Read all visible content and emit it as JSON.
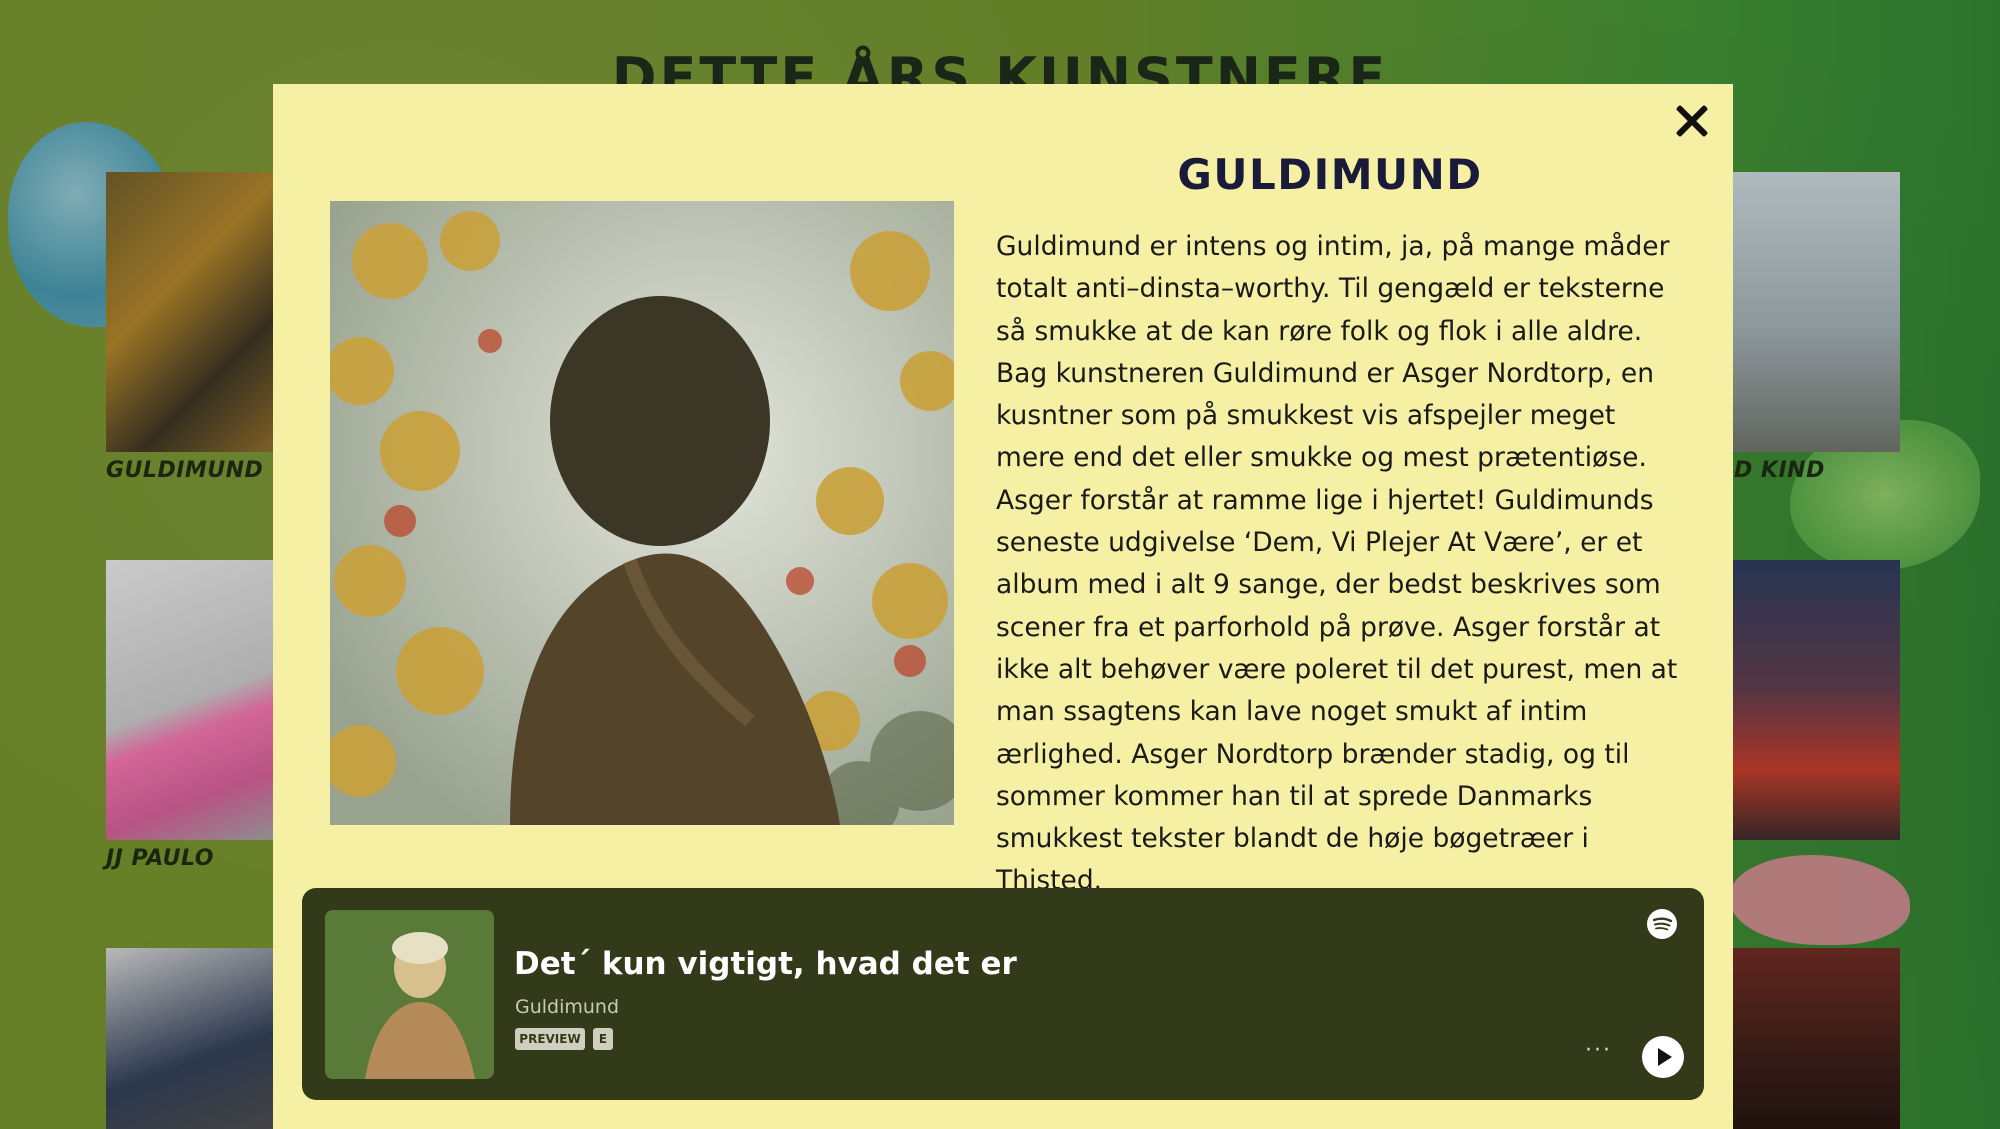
{
  "page": {
    "title": "DETTE ÅRS KUNSTNERE"
  },
  "artists_grid": {
    "left": [
      {
        "label": "GULDIMUND"
      },
      {
        "label": "JJ PAULO"
      },
      {
        "label": ""
      }
    ],
    "right": [
      {
        "label": "D KIND"
      },
      {
        "label": ""
      },
      {
        "label": ""
      }
    ]
  },
  "modal": {
    "close_label": "✕",
    "artist_name": "GULDIMUND",
    "bio": "Guldimund er intens og intim, ja, på mange måder totalt anti–dinsta–worthy. Til gengæld er teksterne så smukke at de kan røre folk og flok i alle aldre. Bag kunstneren Guldimund er Asger Nordtorp, en kusntner som på smukkest vis afspejler meget mere end det eller smukke og mest prætentiøse. Asger forstår at ramme lige i hjertet! Guldimunds seneste udgivelse ‘Dem, Vi Plejer At Være’, er et album med i alt 9 sange, der bedst beskrives som scener fra et parforhold på prøve. Asger forstår at ikke alt behøver være poleret til det purest, men at man ssagtens kan lave noget smukt af intim ærlighed. Asger Nordtorp brænder stadig, og til sommer kommer han til at sprede Danmarks smukkest tekster blandt de høje bøgetræer i Thisted."
  },
  "player": {
    "track_title": "Det´ kun vigtigt, hvad det er",
    "artist": "Guldimund",
    "preview_badge": "PREVIEW",
    "explicit_badge": "E",
    "more_label": "···",
    "icons": {
      "spotify": "spotify-icon",
      "play": "play-icon"
    }
  },
  "colors": {
    "modal_bg": "#f6f0a5",
    "player_bg": "#333a19",
    "background_green": "#6b8a2c"
  }
}
